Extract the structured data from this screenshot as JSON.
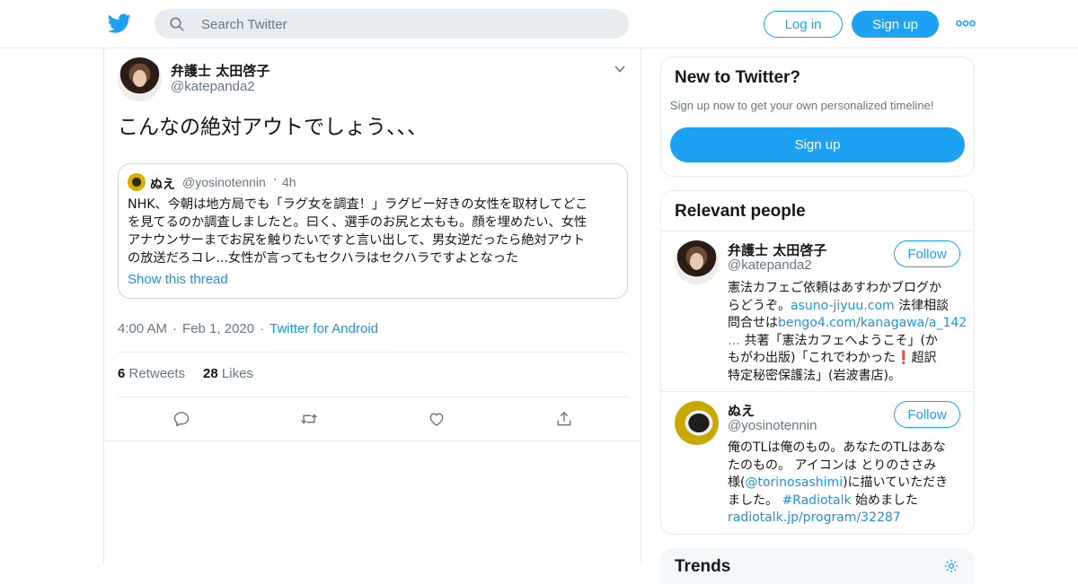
{
  "header": {
    "logo_icon": "twitter-bird-icon",
    "search_placeholder": "Search Twitter",
    "login_label": "Log in",
    "signup_label": "Sign up",
    "more_icon": "more-dots-icon",
    "accent": "#1da1f2"
  },
  "tweet": {
    "author_name": "弁護士 太田啓子",
    "author_handle": "@katepanda2",
    "text": "こんなの絶対アウトでしょう、、、",
    "quote": {
      "name": "ぬえ",
      "handle": "@yosinotennin",
      "dot": "·",
      "time": "4h",
      "lines": [
        "NHK、今朝は地方局でも「ラグ女を調査！」ラグビー好きの女性を取材してどこ",
        "を見てるのか調査しましたと。曰く、選手のお尻と太もも。顔を埋めたい、女性",
        "アナウンサーまでお尻を触りたいですと言い出して、男女逆だったら絶対アウト",
        "の放送だろコレ...女性が言ってもセクハラはセクハラですよとなった"
      ],
      "show_thread": "Show this thread"
    },
    "time": "4:00 AM",
    "date": "Feb 1, 2020",
    "sep": "·",
    "client": "Twitter for Android",
    "retweets_count": "6",
    "retweets_label": "Retweets",
    "likes_count": "28",
    "likes_label": "Likes"
  },
  "sidebar": {
    "new_title": "New to Twitter?",
    "new_sub": "Sign up now to get your own personalized timeline!",
    "new_button": "Sign up",
    "relevant_title": "Relevant people",
    "people": [
      {
        "name": "弁護士 太田啓子",
        "handle": "@katepanda2",
        "follow": "Follow",
        "bio": {
          "l1": "憲法カフェご依頼はあすわかブログか",
          "l2a": "らどうぞ。",
          "l2b": "asuno-jiyuu.com",
          "l2c": " 法律相談",
          "l3a": "問合せは",
          "l3b": "bengo4.com/kanagawa/a_142",
          "l4a": "…",
          "l4b": " 共著「憲法カフェへようこそ」(か",
          "l5": "もがわ出版)「これでわかった",
          "l5_emoji": "❗",
          "l5b": "超訳",
          "l6": "特定秘密保護法」(岩波書店)。"
        }
      },
      {
        "name": "ぬえ",
        "handle": "@yosinotennin",
        "follow": "Follow",
        "bio": {
          "l1": "俺のTLは俺のもの。あなたのTLはあな",
          "l2": "たのもの。 アイコンは とりのささみ",
          "l3a": "様(",
          "l3b": "@torinosashimi",
          "l3c": ")に描いていただき",
          "l4a": "ました。 ",
          "l4b": "#Radiotalk",
          "l4c": " 始めました",
          "l5": "radiotalk.jp/program/32287"
        }
      }
    ],
    "trends_title": "Trends"
  }
}
